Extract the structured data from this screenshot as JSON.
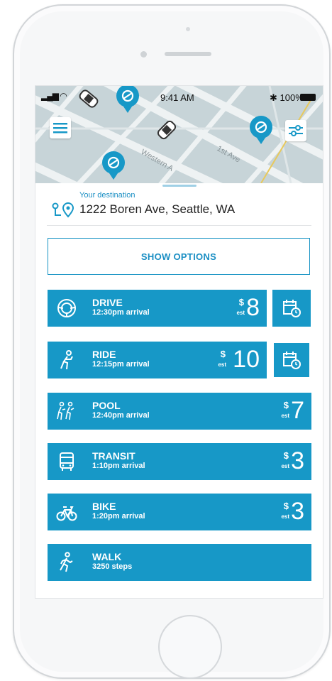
{
  "status_bar": {
    "time": "9:41 AM",
    "battery": "100%"
  },
  "destination": {
    "label": "Your destination",
    "address": "1222 Boren Ave, Seattle, WA"
  },
  "map": {
    "street_labels": [
      "Western A",
      "1st Ave"
    ]
  },
  "show_options_label": "SHOW OPTIONS",
  "options": [
    {
      "name": "DRIVE",
      "detail": "12:30pm arrival",
      "currency": "$",
      "est": "est",
      "price": "8",
      "icon": "steering-wheel-icon"
    },
    {
      "name": "RIDE",
      "detail": "12:15pm arrival",
      "currency": "$",
      "est": "est",
      "price": "10",
      "icon": "rider-icon"
    },
    {
      "name": "POOL",
      "detail": "12:40pm arrival",
      "currency": "$",
      "est": "est",
      "price": "7",
      "icon": "pool-riders-icon"
    },
    {
      "name": "TRANSIT",
      "detail": "1:10pm arrival",
      "currency": "$",
      "est": "est",
      "price": "3",
      "icon": "bus-icon"
    },
    {
      "name": "BIKE",
      "detail": "1:20pm arrival",
      "currency": "$",
      "est": "est",
      "price": "3",
      "icon": "bike-icon"
    },
    {
      "name": "WALK",
      "detail": "3250 steps",
      "icon": "walking-person-icon"
    }
  ],
  "colors": {
    "accent": "#1798c7",
    "accent_text": "#1b8fc4",
    "map_background": "#c8d5d9"
  }
}
